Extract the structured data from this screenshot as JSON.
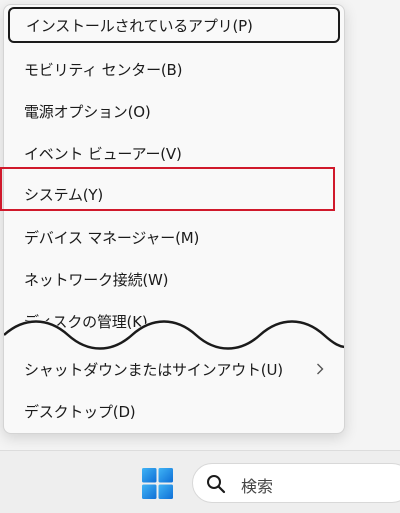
{
  "menu": {
    "items": [
      {
        "label": "インストールされているアプリ(P)"
      },
      {
        "label": "モビリティ センター(B)"
      },
      {
        "label": "電源オプション(O)"
      },
      {
        "label": "イベント ビューアー(V)"
      },
      {
        "label": "システム(Y)"
      },
      {
        "label": "デバイス マネージャー(M)"
      },
      {
        "label": "ネットワーク接続(W)"
      },
      {
        "label": "ディスクの管理(K)"
      },
      {
        "label": "シャットダウンまたはサインアウト(U)"
      },
      {
        "label": "デスクトップ(D)"
      }
    ],
    "submenu_icon": "chevron-right-icon"
  },
  "taskbar": {
    "search_label": "検索",
    "start_icon": "windows-logo-icon",
    "search_icon": "search-icon"
  },
  "colors": {
    "highlight_border": "#d0192b",
    "windows_blue": "#1a73e8"
  }
}
